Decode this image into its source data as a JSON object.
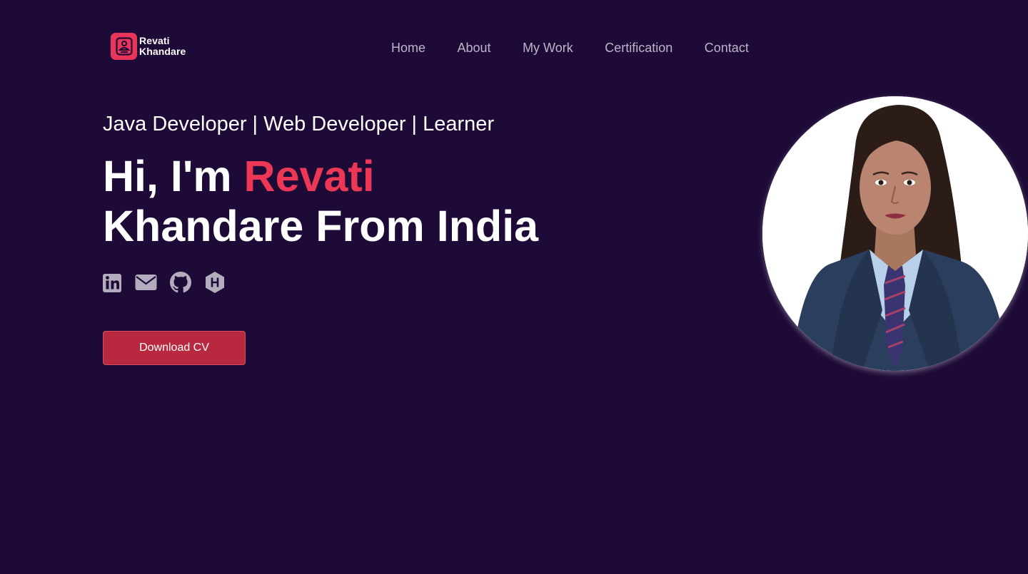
{
  "logo": {
    "line1": "Revati",
    "line2": "Khandare",
    "icon": "person-badge-icon"
  },
  "nav": {
    "items": [
      {
        "label": "Home"
      },
      {
        "label": "About"
      },
      {
        "label": "My Work"
      },
      {
        "label": "Certification"
      },
      {
        "label": "Contact"
      }
    ]
  },
  "hero": {
    "tagline": "Java Developer | Web Developer | Learner",
    "greeting": "Hi, I'm",
    "first_name": "Revati",
    "line2": "Khandare From India"
  },
  "socials": [
    {
      "icon": "linkedin-icon"
    },
    {
      "icon": "envelope-icon"
    },
    {
      "icon": "github-icon"
    },
    {
      "icon": "hashnode-icon"
    }
  ],
  "cta": {
    "label": "Download CV"
  },
  "colors": {
    "background": "#1e0a36",
    "accent": "#ec3756",
    "button": "#b8283f",
    "nav_text": "#bdb4c9",
    "icon": "#b3acbf"
  }
}
